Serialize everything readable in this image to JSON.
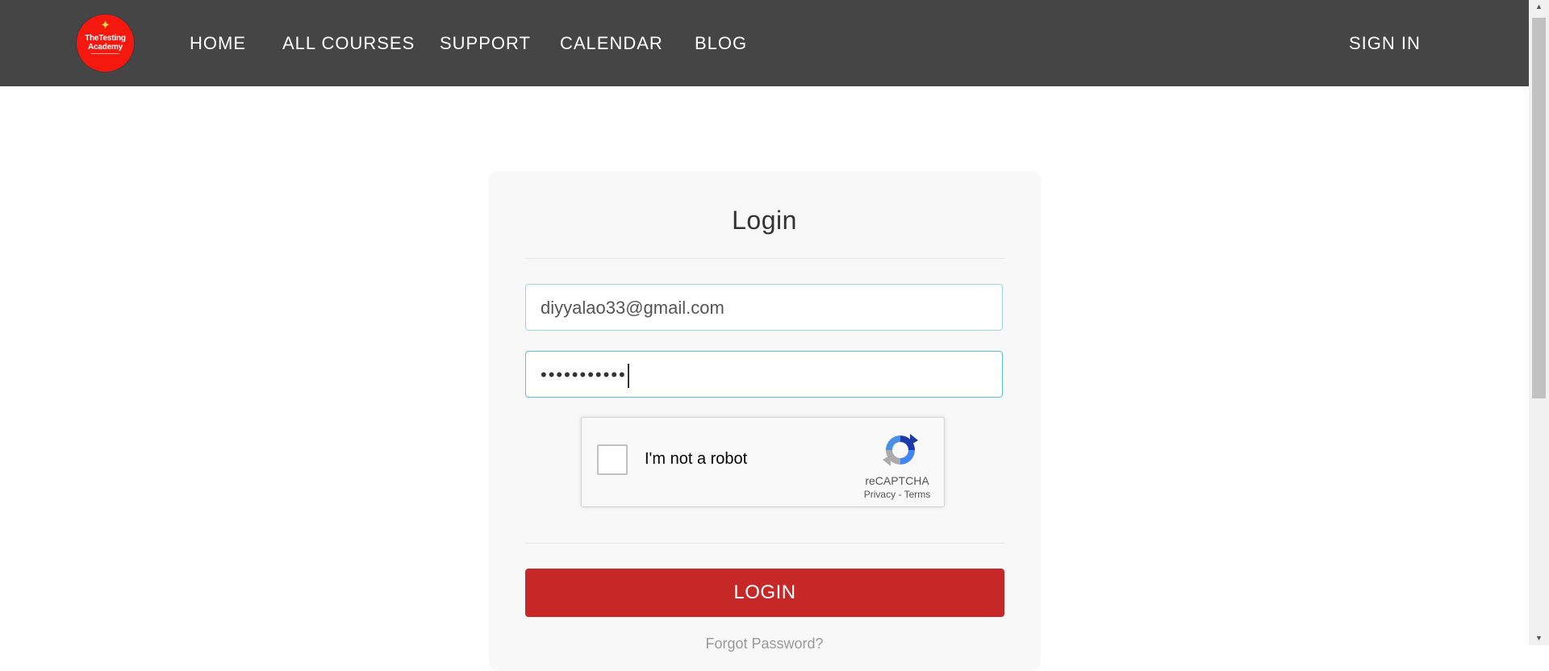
{
  "brand": {
    "logo_text": "TheTesting Academy",
    "logo_color": "#f5180f"
  },
  "nav": {
    "items": [
      {
        "label": "HOME"
      },
      {
        "label": "ALL COURSES"
      },
      {
        "label": "SUPPORT"
      },
      {
        "label": "CALENDAR"
      },
      {
        "label": "BLOG"
      }
    ],
    "sign_in": "SIGN IN",
    "background": "#454545"
  },
  "login": {
    "title": "Login",
    "email_value": "diyyalao33@gmail.com",
    "password_masked": "•••••••••••",
    "button_label": "LOGIN",
    "button_color": "#c62828",
    "forgot_password": "Forgot Password?"
  },
  "recaptcha": {
    "label": "I'm not a robot",
    "brand": "reCAPTCHA",
    "privacy": "Privacy",
    "separator": " - ",
    "terms": "Terms",
    "checked": false
  }
}
